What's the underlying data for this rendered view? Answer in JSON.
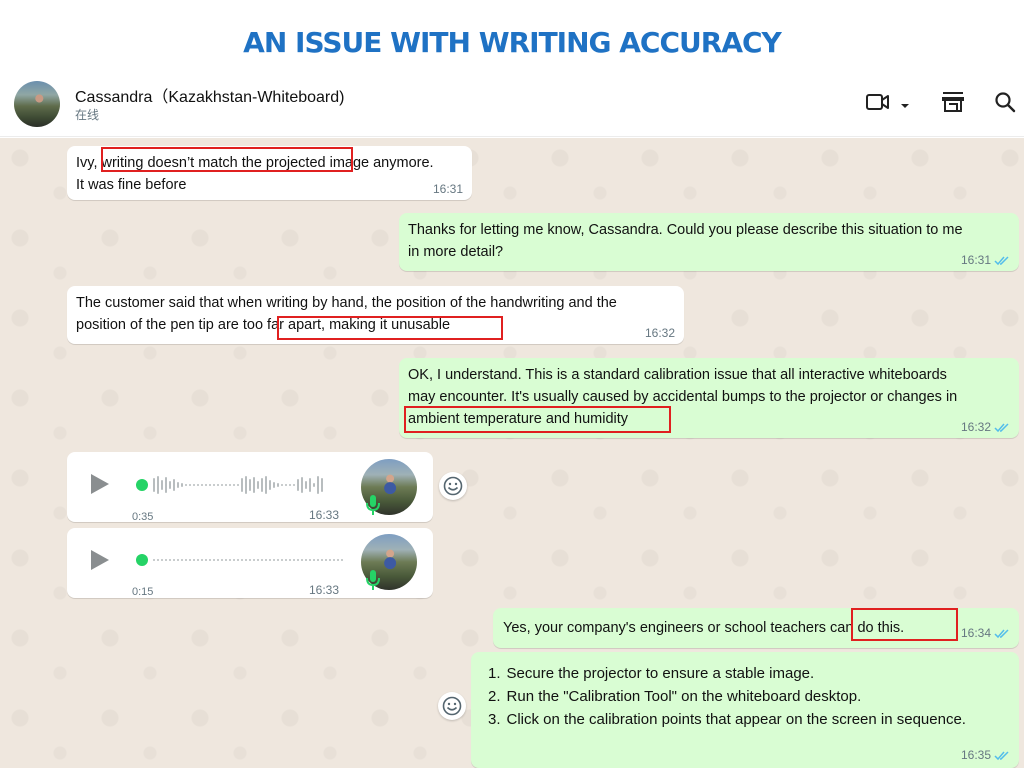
{
  "slide_title": "AN ISSUE WITH WRITING ACCURACY",
  "header": {
    "contact_name": "Cassandra（Kazakhstan-Whiteboard)",
    "status": "在线"
  },
  "messages": {
    "m1": {
      "line1": "Ivy, writing doesn’t match the projected image anymore.",
      "line2": "It was fine before",
      "time": "16:31"
    },
    "m2": {
      "line1": "Thanks for letting me know, Cassandra. Could you please describe this situation to me",
      "line2": "in more detail?",
      "time": "16:31"
    },
    "m3": {
      "line1": "The customer said that when writing by hand, the position of the handwriting and the",
      "line2": "position of the pen tip are too far apart, making it unusable",
      "time": "16:32"
    },
    "m4": {
      "line1": "OK, I understand. This is a standard calibration issue that all interactive whiteboards",
      "line2": "may encounter. It's usually caused by accidental bumps to the projector or changes in",
      "line3": "ambient temperature and humidity",
      "time": "16:32"
    },
    "v1": {
      "duration": "0:35",
      "time": "16:33"
    },
    "v2": {
      "duration": "0:15",
      "time": "16:33"
    },
    "m5": {
      "text": "Yes, your company's engineers or school teachers can do this.",
      "time": "16:34"
    },
    "m6": {
      "steps": [
        {
          "num": "1.",
          "text": "Secure the projector to ensure a stable image."
        },
        {
          "num": "2.",
          "text": "Run the \"Calibration Tool\" on the whiteboard desktop."
        },
        {
          "num": "3.",
          "text": "Click on the calibration points that appear on the screen in sequence."
        }
      ],
      "time": "16:35"
    }
  },
  "colors": {
    "title": "#1f72c4",
    "incoming_bubble": "#ffffff",
    "outgoing_bubble": "#d9fdd3",
    "highlight_box": "#e02020",
    "read_ticks": "#53bdeb",
    "voice_dot": "#25d366"
  },
  "icons": [
    "video-call-icon",
    "dropdown-chevron-icon",
    "shop-icon",
    "search-icon",
    "play-icon",
    "mic-icon",
    "emoji-reaction-icon",
    "read-ticks-icon"
  ]
}
